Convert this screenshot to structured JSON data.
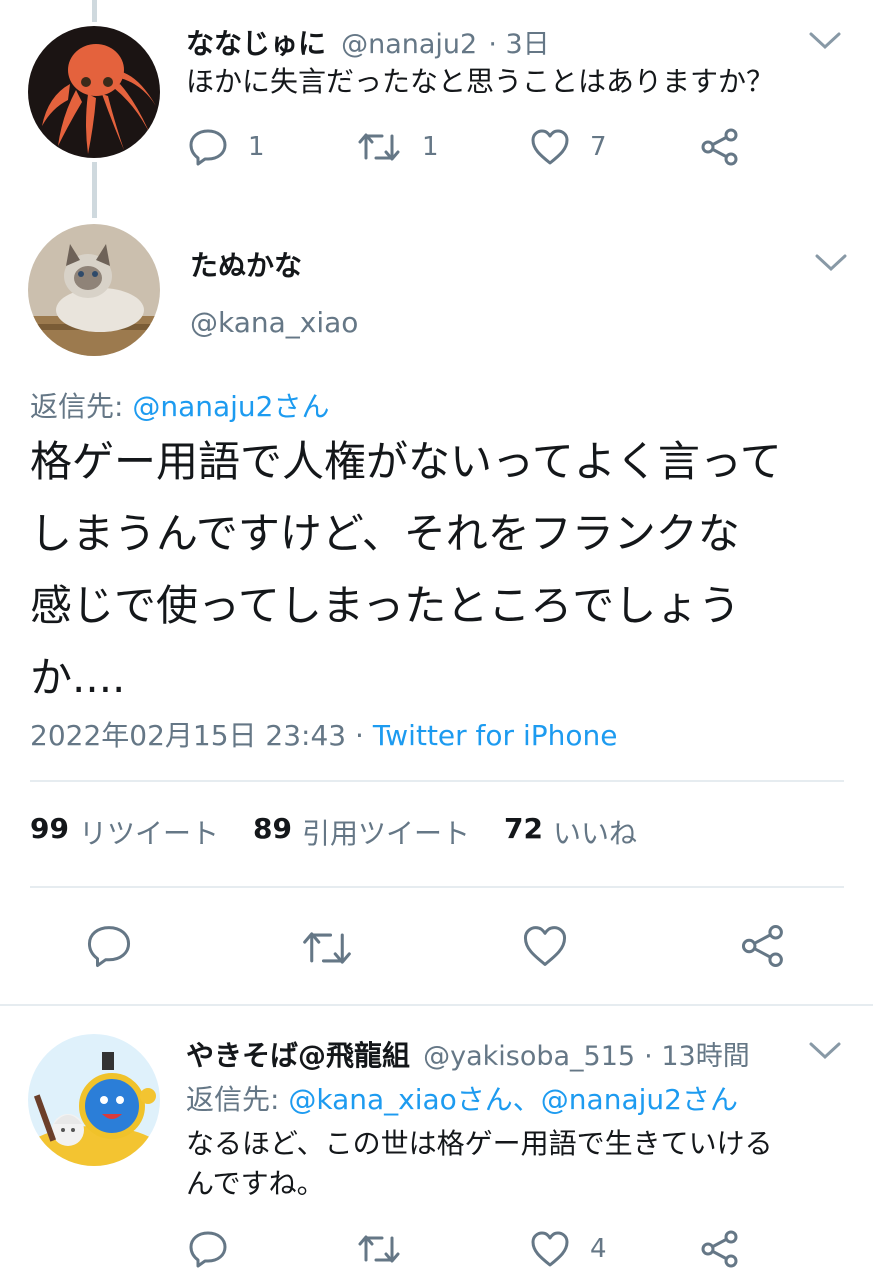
{
  "tweet1": {
    "display_name": "ななじゅに",
    "handle": "@nanaju2",
    "time": "· 3日",
    "text": "ほかに失言だったなと思うことはありますか？",
    "replies": "1",
    "retweets": "1",
    "likes": "7"
  },
  "main": {
    "display_name": "たぬかな",
    "handle": "@kana_xiao",
    "reply_prefix": "返信先: ",
    "reply_to": "@nanaju2さん",
    "text_lines": [
      "格ゲー用語で人権がないってよく言って",
      "しまうんですけど、それをフランクな",
      "感じで使ってしまったところでしょう",
      "か...."
    ],
    "datetime": "2022年02月15日 23:43 · ",
    "source": "Twitter for iPhone",
    "stats": {
      "retweets_count": "99",
      "retweets_label": "リツイート",
      "quotes_count": "89",
      "quotes_label": "引用ツイート",
      "likes_count": "72",
      "likes_label": "いいね"
    }
  },
  "tweet3": {
    "display_name": "やきそば@飛龍組",
    "handle": "@yakisoba_515",
    "time": "· 13時間",
    "reply_prefix": "返信先: ",
    "reply_to_1": "@kana_xiaoさん",
    "reply_sep": "、",
    "reply_to_2": "@nanaju2さん",
    "text_lines": [
      "なるほど、この世は格ゲー用語で生きていける",
      "んですね。"
    ],
    "likes": "4"
  },
  "colors": {
    "link": "#1d9bf0",
    "muted": "#657786",
    "divider": "#e6ecf0",
    "thread_line": "#cfd9de"
  }
}
